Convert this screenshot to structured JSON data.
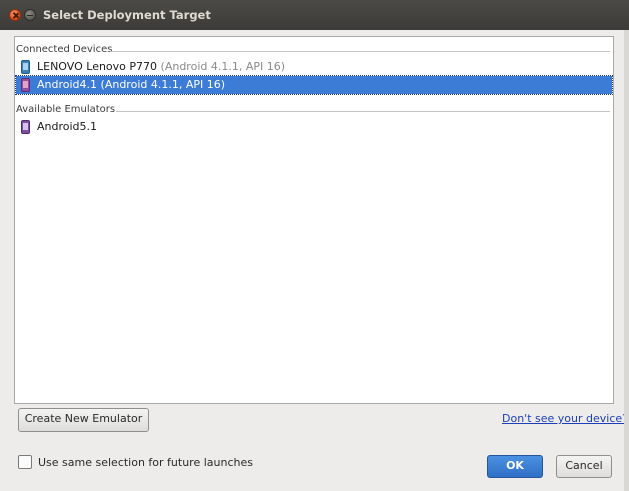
{
  "window": {
    "title": "Select Deployment Target"
  },
  "sections": {
    "connected": {
      "label": "Connected Devices",
      "devices": [
        {
          "name": "LENOVO Lenovo P770",
          "detail": "(Android 4.1.1, API 16)",
          "icon": "phone-device-icon"
        },
        {
          "name": "Android4.1",
          "detail": "(Android 4.1.1, API 16)",
          "icon": "phone-emulator-icon",
          "selected": true
        }
      ]
    },
    "emulators": {
      "label": "Available Emulators",
      "items": [
        {
          "name": "Android5.1",
          "icon": "phone-emulator-icon"
        }
      ]
    }
  },
  "actions": {
    "create_emulator": "Create New Emulator",
    "dont_see_device": "Don't see your device?",
    "remember_selection": "Use same selection for future launches",
    "remember_checked": false,
    "ok": "OK",
    "cancel": "Cancel"
  },
  "colors": {
    "selection": "#3c7cd7",
    "ok_button": "#3a7fd6",
    "link": "#1c3fb8"
  }
}
